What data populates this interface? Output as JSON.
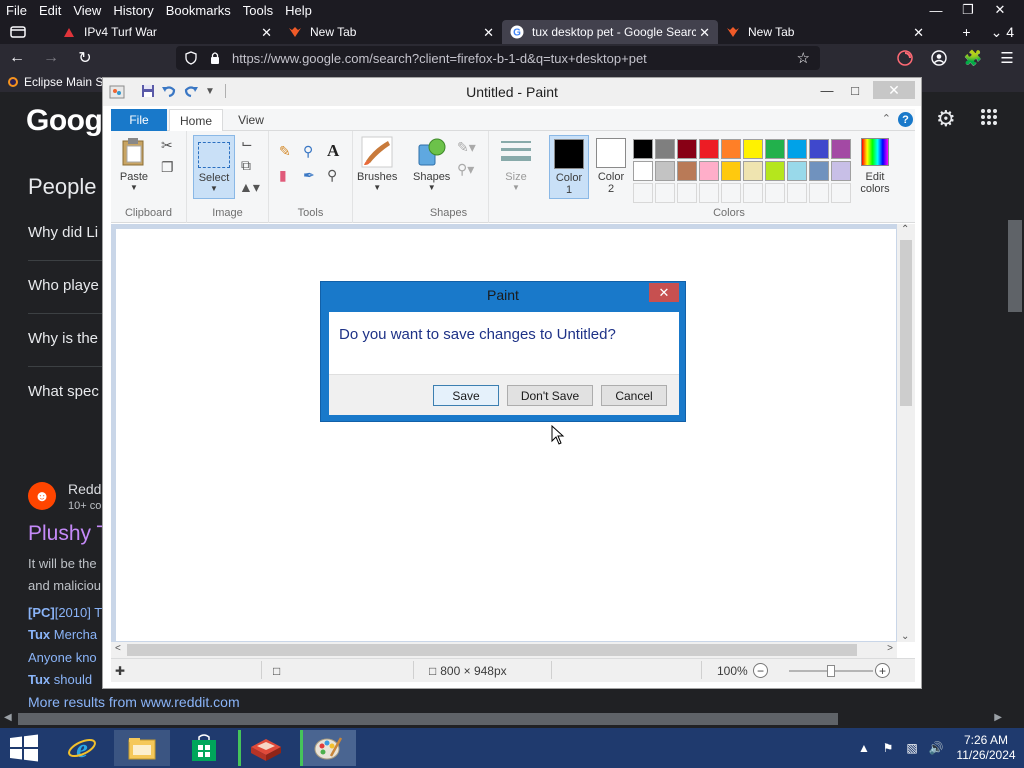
{
  "firefox": {
    "menu": [
      "File",
      "Edit",
      "View",
      "History",
      "Bookmarks",
      "Tools",
      "Help"
    ],
    "tabs": [
      {
        "title": "IPv4 Turf War",
        "active": false
      },
      {
        "title": "New Tab",
        "active": false
      },
      {
        "title": "tux desktop pet - Google Search",
        "active": true
      },
      {
        "title": "New Tab",
        "active": false
      }
    ],
    "tab_count_label": "4",
    "url": "https://www.google.com/search?client=firefox-b-1-d&q=tux+desktop+pet",
    "bookmark": "Eclipse Main S"
  },
  "google": {
    "logo": "Googl",
    "people_also_ask": "People a",
    "questions": [
      "Why did Li",
      "Who playe",
      "Why is the",
      "What spec"
    ],
    "result": {
      "site": "Redd",
      "site_sub": "10+ co",
      "title": "Plushy T",
      "snippet_1": "It will be the",
      "snippet_2": "and maliciou",
      "link_1_prefix": "[PC]",
      "link_1": "[2010] T",
      "link_2_bold": "Tux",
      "link_2": " Mercha",
      "link_3": "Anyone kno",
      "link_4_bold": "Tux",
      "link_4": " should",
      "more": "More results from www.reddit.com"
    }
  },
  "paint": {
    "title": "Untitled - Paint",
    "tabs": {
      "file": "File",
      "home": "Home",
      "view": "View"
    },
    "groups": {
      "clipboard": "Clipboard",
      "image": "Image",
      "tools": "Tools",
      "shapes": "Shapes",
      "colors": "Colors"
    },
    "buttons": {
      "paste": "Paste",
      "select": "Select",
      "brushes": "Brushes",
      "shapes": "Shapes",
      "size": "Size",
      "color1_line1": "Color",
      "color1_line2": "1",
      "color2_line1": "Color",
      "color2_line2": "2",
      "edit_colors_line1": "Edit",
      "edit_colors_line2": "colors"
    },
    "palette": [
      "#000000",
      "#7f7f7f",
      "#880015",
      "#ed1c24",
      "#ff7f27",
      "#fff200",
      "#22b14c",
      "#00a2e8",
      "#3f48cc",
      "#a349a4",
      "#ffffff",
      "#c3c3c3",
      "#b97a57",
      "#ffaec9",
      "#ffc90e",
      "#efe4b0",
      "#b5e61d",
      "#99d9ea",
      "#7092be",
      "#c8bfe7"
    ],
    "color1": "#000000",
    "color2": "#ffffff",
    "status": {
      "dimensions": "800 × 948px",
      "zoom": "100%"
    }
  },
  "dialog": {
    "title": "Paint",
    "message": "Do you want to save changes to Untitled?",
    "save": "Save",
    "dont_save": "Don't Save",
    "cancel": "Cancel"
  },
  "taskbar": {
    "time": "7:26 AM",
    "date": "11/26/2024"
  }
}
